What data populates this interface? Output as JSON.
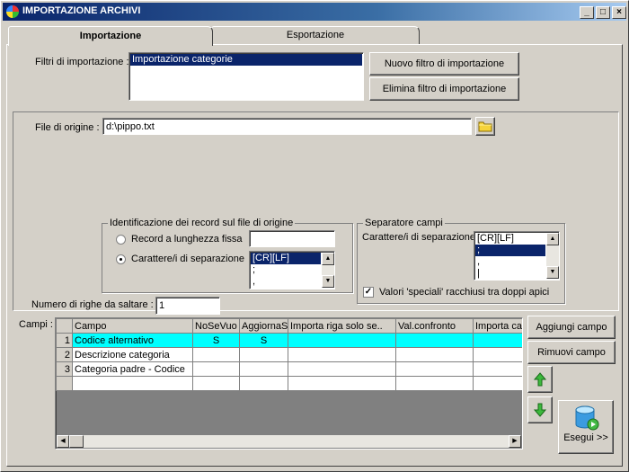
{
  "window": {
    "title": "IMPORTAZIONE ARCHIVI",
    "controls": {
      "minimize": "_",
      "maximize": "□",
      "close": "×"
    }
  },
  "tabs": [
    {
      "label": "Importazione",
      "active": true
    },
    {
      "label": "Esportazione",
      "active": false
    }
  ],
  "filters": {
    "label": "Filtri di importazione :",
    "items": [
      "Importazione categorie"
    ],
    "selected_index": 0,
    "new_button": "Nuovo filtro di importazione",
    "delete_button": "Elimina filtro di importazione"
  },
  "source": {
    "label": "File di origine :",
    "value": "d:\\pippo.txt"
  },
  "record_id": {
    "legend": "Identificazione dei record sul file di origine",
    "fixed_length_label": "Record a lunghezza fissa",
    "fixed_length_value": "",
    "separator_label": "Carattere/i di separazione",
    "selected_option": "separator",
    "separator_items": [
      "[CR][LF]",
      ";",
      ","
    ]
  },
  "field_separator": {
    "legend": "Separatore campi",
    "label": "Carattere/i di separazione",
    "items": [
      "[CR][LF]",
      ";",
      ",",
      "|"
    ],
    "selected_index": 1,
    "special_values_label": "Valori 'speciali' racchiusi tra doppi apici",
    "special_values_checked": true
  },
  "skip_rows": {
    "label": "Numero di righe da saltare  :",
    "value": "1"
  },
  "fields": {
    "label": "Campi :",
    "columns": [
      "Campo",
      "NoSeVuo",
      "AggiornaS",
      "Importa riga solo se..",
      "Val.confronto",
      "Importa ca"
    ],
    "rows": [
      {
        "num": "1",
        "cells": [
          "Codice alternativo",
          "S",
          "S",
          "",
          "",
          ""
        ]
      },
      {
        "num": "2",
        "cells": [
          "Descrizione categoria",
          "",
          "",
          "",
          "",
          ""
        ]
      },
      {
        "num": "3",
        "cells": [
          "Categoria padre - Codice",
          "",
          "",
          "",
          "",
          ""
        ]
      }
    ],
    "highlight_row": 0,
    "highlight_color": "#00ffff",
    "add_button": "Aggiungi campo",
    "remove_button": "Rimuovi campo",
    "move_up_icon": "arrow-up-icon",
    "move_down_icon": "arrow-down-icon"
  },
  "execute_button": "Esegui >>",
  "colors": {
    "titlebar": "#0a246a",
    "selection": "#0a246a",
    "face": "#d4d0c8",
    "grid_empty": "#808080"
  }
}
